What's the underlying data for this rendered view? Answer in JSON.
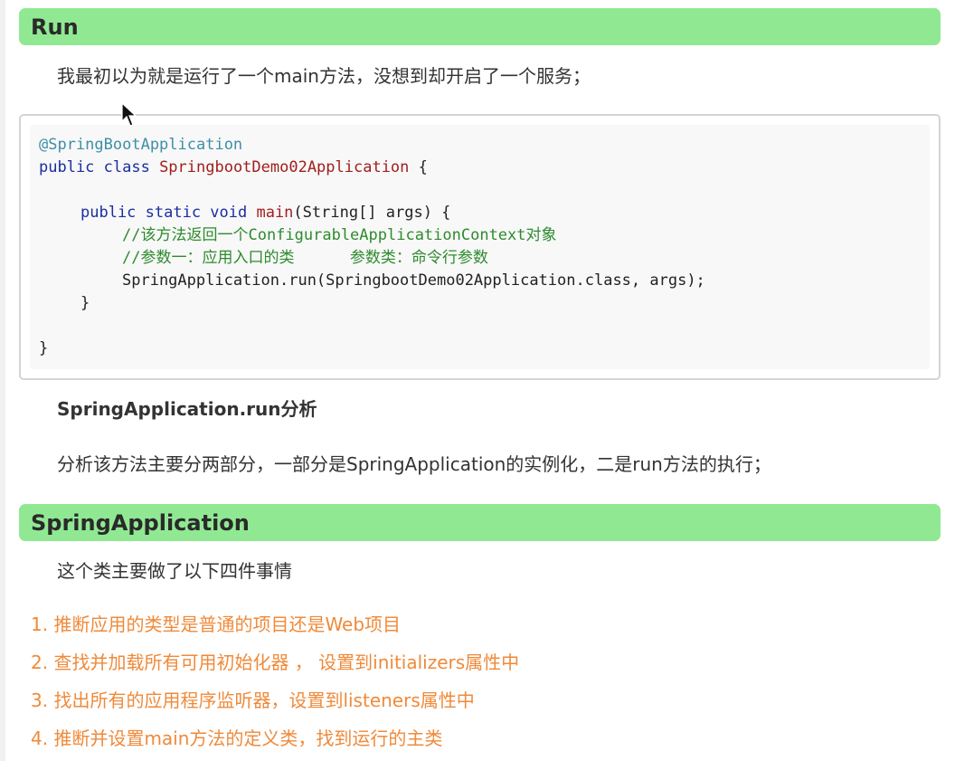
{
  "sections": {
    "run_title": "Run",
    "spring_app_title": "SpringApplication"
  },
  "run": {
    "intro": "我最初以为就是运行了一个main方法，没想到却开启了一个服务；",
    "code": {
      "l1_annotation": "@SpringBootApplication",
      "l2_kw": "public class ",
      "l2_cls": "SpringbootDemo02Application",
      "l2_rest": " {",
      "l4_kw": "public static void ",
      "l4_fn": "main",
      "l4_rest": "(String[] args) {",
      "l5_comment": "//该方法返回一个ConfigurableApplicationContext对象",
      "l6_comment": "//参数一：应用入口的类      参数类：命令行参数",
      "l7_stmt": "SpringApplication.run(SpringbootDemo02Application.class, args);",
      "l8_close": "}",
      "l10_close": "}"
    },
    "analysis_heading": "SpringApplication.run分析",
    "analysis_text": "分析该方法主要分两部分，一部分是SpringApplication的实例化，二是run方法的执行；"
  },
  "spring_app": {
    "intro": "这个类主要做了以下四件事情",
    "items": [
      "1. 推断应用的类型是普通的项目还是Web项目",
      "2. 查找并加载所有可用初始化器 ， 设置到initializers属性中",
      "3. 找出所有的应用程序监听器，设置到listeners属性中",
      "4. 推断并设置main方法的定义类，找到运行的主类"
    ]
  },
  "colors": {
    "header_bg": "#90e992",
    "list_text": "#ef8a3a",
    "comment": "#2e8b2e",
    "keyword": "#1a2ea0"
  },
  "icons": {
    "pointer": "mouse-cursor-icon"
  }
}
